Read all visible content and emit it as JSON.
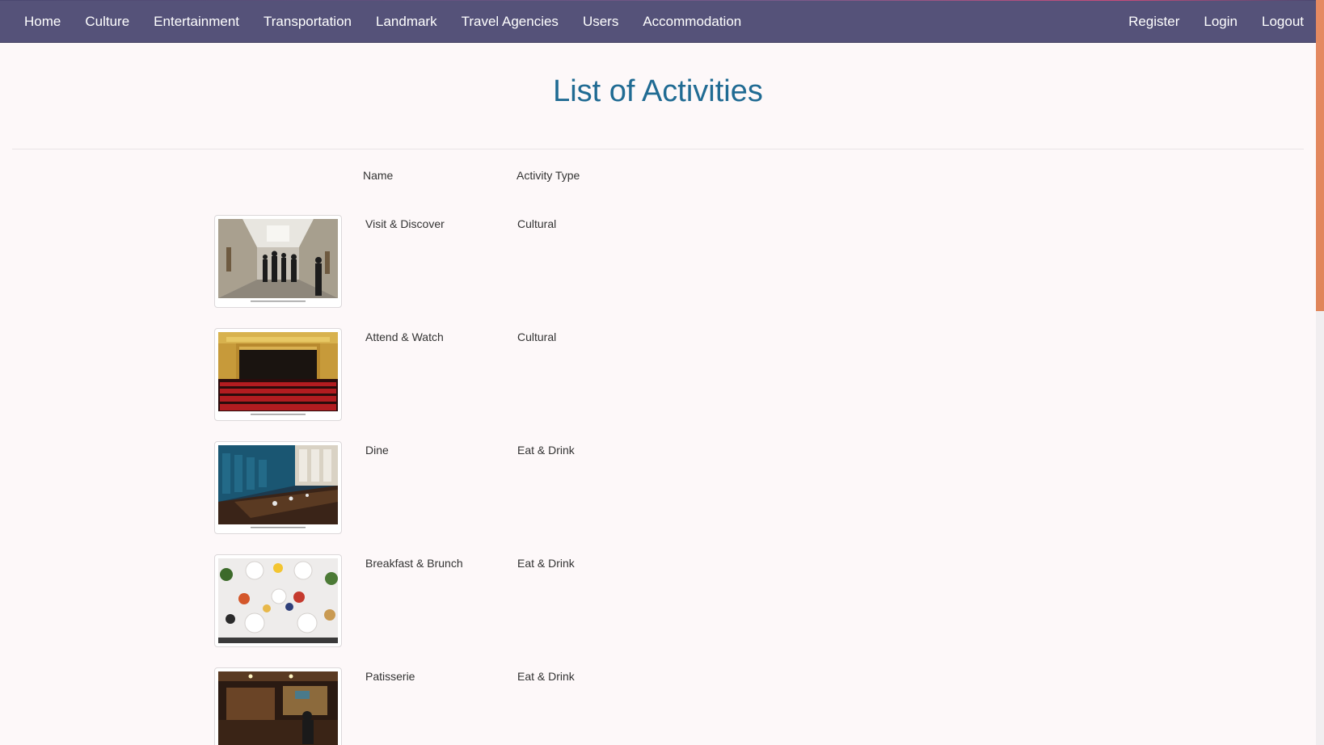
{
  "navbar": {
    "left_items": [
      {
        "label": "Home"
      },
      {
        "label": "Culture"
      },
      {
        "label": "Entertainment"
      },
      {
        "label": "Transportation"
      },
      {
        "label": "Landmark"
      },
      {
        "label": "Travel Agencies"
      },
      {
        "label": "Users"
      },
      {
        "label": "Accommodation"
      }
    ],
    "right_items": [
      {
        "label": "Register"
      },
      {
        "label": "Login"
      },
      {
        "label": "Logout"
      }
    ]
  },
  "page": {
    "title": "List of Activities"
  },
  "table": {
    "headers": {
      "name": "Name",
      "type": "Activity Type"
    },
    "rows": [
      {
        "name": "Visit & Discover",
        "type": "Cultural",
        "image": "museum-gallery-photo"
      },
      {
        "name": "Attend & Watch",
        "type": "Cultural",
        "image": "theater-stage-photo"
      },
      {
        "name": "Dine",
        "type": "Eat & Drink",
        "image": "restaurant-interior-photo"
      },
      {
        "name": "Breakfast & Brunch",
        "type": "Eat & Drink",
        "image": "breakfast-table-photo"
      },
      {
        "name": "Patisserie",
        "type": "Eat & Drink",
        "image": "patisserie-shop-photo"
      }
    ]
  },
  "colors": {
    "navbar_bg": "#555279",
    "title": "#206b93",
    "page_bg": "#fdf8f9",
    "scroll_thumb": "#e58a62"
  }
}
